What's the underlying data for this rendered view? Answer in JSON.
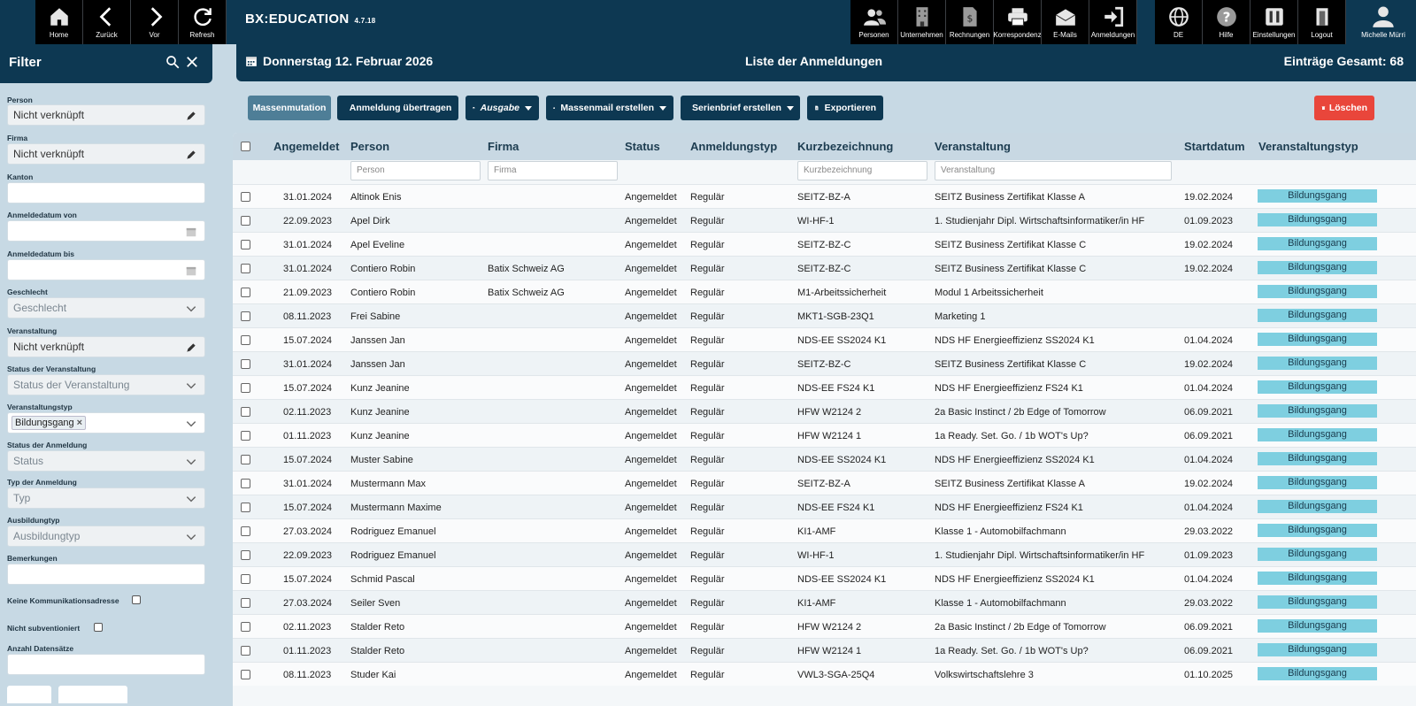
{
  "app": {
    "name": "BX:EDUCATION",
    "version": "4.7.18",
    "user": "Michelle Mürri"
  },
  "nav_left": [
    {
      "label": "Home",
      "icon": "home-icon"
    },
    {
      "label": "Zurück",
      "icon": "chevron-left-icon"
    },
    {
      "label": "Vor",
      "icon": "chevron-right-icon"
    },
    {
      "label": "Refresh",
      "icon": "refresh-icon"
    }
  ],
  "nav_right": [
    {
      "label": "Personen",
      "icon": "people-icon"
    },
    {
      "label": "Unternehmen",
      "icon": "building-icon"
    },
    {
      "label": "Rechnungen",
      "icon": "invoice-icon"
    },
    {
      "label": "Korrespondenz",
      "icon": "printer-icon"
    },
    {
      "label": "E-Mails",
      "icon": "mail-icon"
    },
    {
      "label": "Anmeldungen",
      "icon": "sign-in-icon"
    }
  ],
  "nav_right2": [
    {
      "label": "DE",
      "icon": "globe-icon"
    },
    {
      "label": "Hilfe",
      "icon": "help-icon"
    },
    {
      "label": "Einstellungen",
      "icon": "settings-icon"
    },
    {
      "label": "Logout",
      "icon": "logout-icon"
    }
  ],
  "header": {
    "date": "Donnerstag 12. Februar 2026",
    "title": "Liste der Anmeldungen",
    "total": "Einträge Gesamt: 68"
  },
  "filter": {
    "title": "Filter",
    "fields": {
      "person": {
        "label": "Person",
        "value": "Nicht verknüpft"
      },
      "firma": {
        "label": "Firma",
        "value": "Nicht verknüpft"
      },
      "kanton": {
        "label": "Kanton",
        "value": ""
      },
      "datum_von": {
        "label": "Anmeldedatum von",
        "value": ""
      },
      "datum_bis": {
        "label": "Anmeldedatum bis",
        "value": ""
      },
      "geschlecht": {
        "label": "Geschlecht",
        "value": "Geschlecht"
      },
      "veranstaltung": {
        "label": "Veranstaltung",
        "value": "Nicht verknüpft"
      },
      "status_veranstaltung": {
        "label": "Status der Veranstaltung",
        "value": "Status der Veranstaltung"
      },
      "veranstaltungstyp": {
        "label": "Veranstaltungstyp",
        "value": "Bildungsgang"
      },
      "status_anmeldung": {
        "label": "Status der Anmeldung",
        "value": "Status"
      },
      "typ_anmeldung": {
        "label": "Typ der Anmeldung",
        "value": "Typ"
      },
      "ausbildungtyp": {
        "label": "Ausbildungtyp",
        "value": "Ausbildungtyp"
      },
      "bemerkungen": {
        "label": "Bemerkungen",
        "value": ""
      },
      "keine_komm": {
        "label": "Keine Kommunikationsadresse"
      },
      "nicht_subv": {
        "label": "Nicht subventioniert"
      },
      "anzahl": {
        "label": "Anzahl Datensätze",
        "value": ""
      }
    }
  },
  "toolbar": {
    "massenmutation": "Massenmutation",
    "uebertragen": "Anmeldung übertragen",
    "ausgabe": "Ausgabe",
    "massenmail": "Massenmail erstellen",
    "serienbrief": "Serienbrief erstellen",
    "exportieren": "Exportieren",
    "loeschen": "Löschen"
  },
  "table": {
    "columns": [
      "Angemeldet",
      "Person",
      "Firma",
      "Status",
      "Anmeldungstyp",
      "Kurzbezeichnung",
      "Veranstaltung",
      "Startdatum",
      "Veranstaltungstyp"
    ],
    "filters": {
      "person": "Person",
      "firma": "Firma",
      "kurz": "Kurzbezeichnung",
      "veranstaltung": "Veranstaltung"
    },
    "rows": [
      [
        "31.01.2024",
        "Altinok Enis",
        "",
        "Angemeldet",
        "Regulär",
        "SEITZ-BZ-A",
        "SEITZ Business Zertifikat Klasse A",
        "19.02.2024",
        "Bildungsgang"
      ],
      [
        "22.09.2023",
        "Apel Dirk",
        "",
        "Angemeldet",
        "Regulär",
        "WI-HF-1",
        "1. Studienjahr Dipl. Wirtschaftsinformatiker/in HF",
        "01.09.2023",
        "Bildungsgang"
      ],
      [
        "31.01.2024",
        "Apel Eveline",
        "",
        "Angemeldet",
        "Regulär",
        "SEITZ-BZ-C",
        "SEITZ Business Zertifikat Klasse C",
        "19.02.2024",
        "Bildungsgang"
      ],
      [
        "31.01.2024",
        "Contiero Robin",
        "Batix Schweiz AG",
        "Angemeldet",
        "Regulär",
        "SEITZ-BZ-C",
        "SEITZ Business Zertifikat Klasse C",
        "19.02.2024",
        "Bildungsgang"
      ],
      [
        "21.09.2023",
        "Contiero Robin",
        "Batix Schweiz AG",
        "Angemeldet",
        "Regulär",
        "M1-Arbeitssicherheit",
        "Modul 1 Arbeitssicherheit",
        "",
        "Bildungsgang"
      ],
      [
        "08.11.2023",
        "Frei Sabine",
        "",
        "Angemeldet",
        "Regulär",
        "MKT1-SGB-23Q1",
        "Marketing 1",
        "",
        "Bildungsgang"
      ],
      [
        "15.07.2024",
        "Janssen Jan",
        "",
        "Angemeldet",
        "Regulär",
        "NDS-EE SS2024 K1",
        "NDS HF Energieeffizienz SS2024 K1",
        "01.04.2024",
        "Bildungsgang"
      ],
      [
        "31.01.2024",
        "Janssen Jan",
        "",
        "Angemeldet",
        "Regulär",
        "SEITZ-BZ-C",
        "SEITZ Business Zertifikat Klasse C",
        "19.02.2024",
        "Bildungsgang"
      ],
      [
        "15.07.2024",
        "Kunz Jeanine",
        "",
        "Angemeldet",
        "Regulär",
        "NDS-EE FS24 K1",
        "NDS HF Energieeffizienz FS24 K1",
        "01.04.2024",
        "Bildungsgang"
      ],
      [
        "02.11.2023",
        "Kunz Jeanine",
        "",
        "Angemeldet",
        "Regulär",
        "HFW W2124 2",
        "2a Basic Instinct / 2b Edge of Tomorrow",
        "06.09.2021",
        "Bildungsgang"
      ],
      [
        "01.11.2023",
        "Kunz Jeanine",
        "",
        "Angemeldet",
        "Regulär",
        "HFW W2124 1",
        "1a Ready. Set. Go. / 1b WOT's Up?",
        "06.09.2021",
        "Bildungsgang"
      ],
      [
        "15.07.2024",
        "Muster Sabine",
        "",
        "Angemeldet",
        "Regulär",
        "NDS-EE SS2024 K1",
        "NDS HF Energieeffizienz SS2024 K1",
        "01.04.2024",
        "Bildungsgang"
      ],
      [
        "31.01.2024",
        "Mustermann Max",
        "",
        "Angemeldet",
        "Regulär",
        "SEITZ-BZ-A",
        "SEITZ Business Zertifikat Klasse A",
        "19.02.2024",
        "Bildungsgang"
      ],
      [
        "15.07.2024",
        "Mustermann Maxime",
        "",
        "Angemeldet",
        "Regulär",
        "NDS-EE FS24 K1",
        "NDS HF Energieeffizienz FS24 K1",
        "01.04.2024",
        "Bildungsgang"
      ],
      [
        "27.03.2024",
        "Rodriguez Emanuel",
        "",
        "Angemeldet",
        "Regulär",
        "KI1-AMF",
        "Klasse 1 - Automobilfachmann",
        "29.03.2022",
        "Bildungsgang"
      ],
      [
        "22.09.2023",
        "Rodriguez Emanuel",
        "",
        "Angemeldet",
        "Regulär",
        "WI-HF-1",
        "1. Studienjahr Dipl. Wirtschaftsinformatiker/in HF",
        "01.09.2023",
        "Bildungsgang"
      ],
      [
        "15.07.2024",
        "Schmid Pascal",
        "",
        "Angemeldet",
        "Regulär",
        "NDS-EE SS2024 K1",
        "NDS HF Energieeffizienz SS2024 K1",
        "01.04.2024",
        "Bildungsgang"
      ],
      [
        "27.03.2024",
        "Seiler Sven",
        "",
        "Angemeldet",
        "Regulär",
        "KI1-AMF",
        "Klasse 1 - Automobilfachmann",
        "29.03.2022",
        "Bildungsgang"
      ],
      [
        "02.11.2023",
        "Stalder Reto",
        "",
        "Angemeldet",
        "Regulär",
        "HFW W2124 2",
        "2a Basic Instinct / 2b Edge of Tomorrow",
        "06.09.2021",
        "Bildungsgang"
      ],
      [
        "01.11.2023",
        "Stalder Reto",
        "",
        "Angemeldet",
        "Regulär",
        "HFW W2124 1",
        "1a Ready. Set. Go. / 1b WOT's Up?",
        "06.09.2021",
        "Bildungsgang"
      ],
      [
        "08.11.2023",
        "Studer Kai",
        "",
        "Angemeldet",
        "Regulär",
        "VWL3-SGA-25Q4",
        "Volkswirtschaftslehre 3",
        "01.10.2025",
        "Bildungsgang"
      ]
    ]
  }
}
